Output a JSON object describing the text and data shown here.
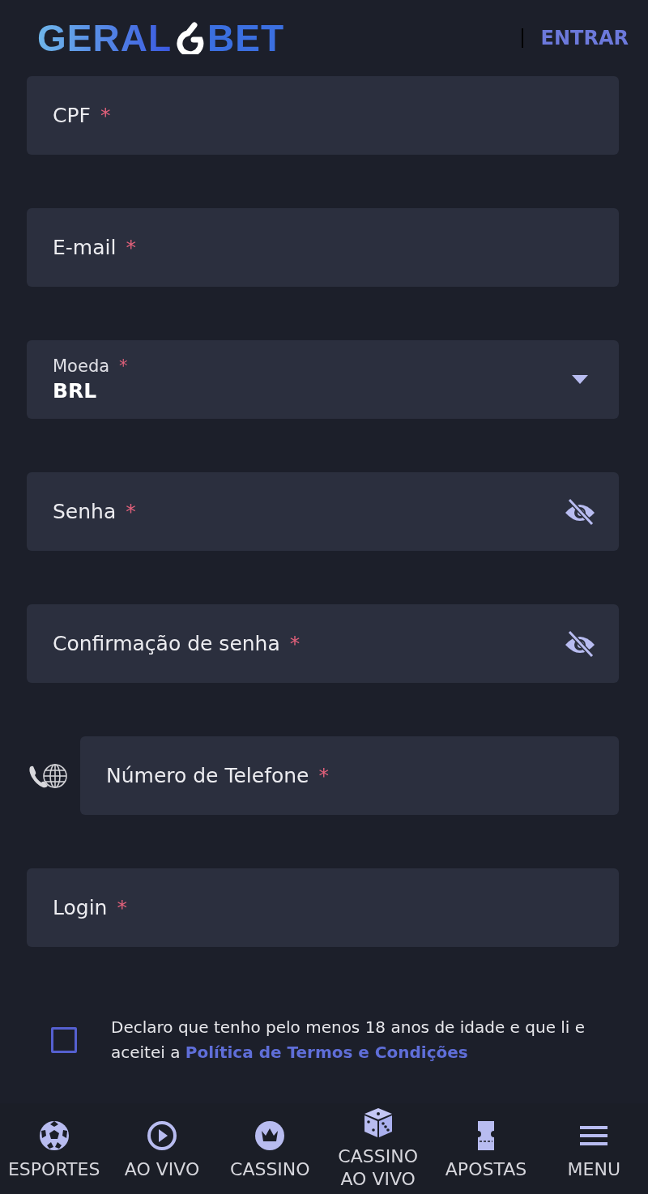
{
  "header": {
    "logo_left": "GERAL",
    "logo_right": "BET",
    "login_link": "ENTRAR"
  },
  "fields": [
    {
      "kind": "text",
      "label": "CPF",
      "required": "*"
    },
    {
      "kind": "text",
      "label": "E-mail",
      "required": "*"
    },
    {
      "kind": "select",
      "label": "Moeda",
      "required": "*",
      "value": "BRL"
    },
    {
      "kind": "password",
      "label": "Senha",
      "required": "*"
    },
    {
      "kind": "password",
      "label": "Confirmação de senha",
      "required": "*"
    },
    {
      "kind": "phone",
      "label": "Número de Telefone",
      "required": "*"
    },
    {
      "kind": "text",
      "label": "Login",
      "required": "*"
    }
  ],
  "terms": {
    "checked": false,
    "text": "Declaro que tenho pelo menos 18 anos de idade e que li e aceitei a",
    "link": "Política de Termos e Condições"
  },
  "bottom_nav": [
    {
      "kind": "ball",
      "label": "ESPORTES"
    },
    {
      "kind": "play",
      "label": "AO VIVO"
    },
    {
      "kind": "crown",
      "label": "CASSINO"
    },
    {
      "kind": "dice",
      "label": "CASSINO AO VIVO"
    },
    {
      "kind": "ticket",
      "label": "APOSTAS"
    },
    {
      "kind": "menu",
      "label": "MENU"
    }
  ]
}
